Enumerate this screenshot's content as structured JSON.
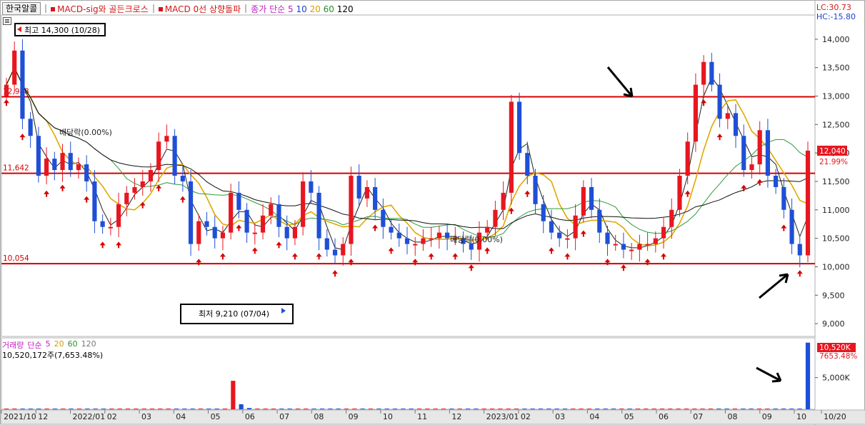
{
  "header": {
    "stock_name": "한국알콜",
    "indicator1": "MACD-sig와 골든크로스",
    "indicator2": "MACD 0선 상향돌파",
    "ma_label": "종가 단순",
    "ma_periods": [
      "5",
      "10",
      "20",
      "60",
      "120"
    ]
  },
  "corner": {
    "lc": "LC:30.73",
    "hc": "HC:-15.80"
  },
  "annotations": {
    "high": "최고 14,300 (10/28)",
    "low": "최저 9,210 (07/04)",
    "dividend1": "배당락(0.00%)",
    "dividend2": "배당락(0.00%)",
    "current_price": "12,040",
    "current_change": "21.99%",
    "hline_labels": [
      "12,988",
      "11,642",
      "10,054"
    ]
  },
  "volume_panel": {
    "title": "거래량",
    "ma_label": "단순",
    "ma_periods": [
      "5",
      "20",
      "60",
      "120"
    ],
    "info": "10,520,172주(7,653.48%)",
    "current_value": "10,520K",
    "current_pct": "7653.48%"
  },
  "colors": {
    "up": "#e8161f",
    "down": "#1e4fd6",
    "ma5": "#202020",
    "ma20": "#e0a800",
    "ma60": "#2e9a3a",
    "ma120": "#111111",
    "hline": "#d40000"
  },
  "chart_data": [
    {
      "type": "candlestick",
      "title": "",
      "ylim": [
        8800,
        14400
      ],
      "y_ticks": [
        "14,000",
        "13,500",
        "13,000",
        "12,500",
        "12,000",
        "11,500",
        "11,000",
        "10,500",
        "10,000",
        "9,500",
        "9,000"
      ],
      "x_ticks": [
        "2021/10",
        "12",
        "2022/01",
        "02",
        "03",
        "04",
        "05",
        "06",
        "07",
        "08",
        "09",
        "10",
        "11",
        "12",
        "2023/01",
        "02",
        "03",
        "04",
        "05",
        "06",
        "07",
        "08",
        "09",
        "10",
        "10/20"
      ],
      "horizontal_lines": [
        12988,
        11642,
        10054
      ],
      "series": [
        {
          "name": "종가",
          "values": [
            13200,
            13800,
            12600,
            12300,
            11600,
            11900,
            11700,
            12000,
            11700,
            11800,
            11500,
            10800,
            10700,
            10700,
            11100,
            11300,
            11400,
            11500,
            11700,
            12200,
            12300,
            11600,
            11500,
            10400,
            10800,
            10700,
            10500,
            10600,
            11300,
            11000,
            10600,
            10600,
            10900,
            11100,
            10700,
            10500,
            10700,
            11500,
            11300,
            10500,
            10300,
            10200,
            10400,
            11600,
            11200,
            11400,
            11000,
            10700,
            10600,
            10500,
            10400,
            10400,
            10500,
            10500,
            10600,
            10500,
            10500,
            10400,
            10300,
            10600,
            10700,
            11000,
            11300,
            12900,
            12000,
            11600,
            11100,
            10800,
            10600,
            10500,
            10500,
            10900,
            11400,
            11000,
            10600,
            10400,
            10400,
            10300,
            10300,
            10400,
            10400,
            10500,
            10700,
            11000,
            11600,
            12200,
            13200,
            13600,
            13200,
            12600,
            12700,
            12300,
            11700,
            11800,
            12400,
            11600,
            11400,
            11000,
            10400,
            10200,
            12040
          ],
          "ma": {
            "5": [],
            "20": [],
            "60": [],
            "120": []
          }
        }
      ],
      "markers": {
        "buy_signals": 42
      }
    },
    {
      "type": "bar",
      "title": "",
      "y_ticks": [
        "5,000K"
      ],
      "ylim": [
        0,
        10600
      ],
      "unit": "K",
      "values": [
        60,
        40,
        30,
        20,
        10,
        10,
        10,
        10,
        10,
        10,
        10,
        10,
        10,
        10,
        10,
        10,
        10,
        10,
        10,
        10,
        10,
        10,
        10,
        10,
        10,
        10,
        10,
        10,
        4500,
        800,
        200,
        100,
        80,
        60,
        40,
        30,
        30,
        30,
        30,
        30,
        30,
        60,
        40,
        30,
        20,
        20,
        20,
        20,
        20,
        20,
        20,
        20,
        20,
        20,
        20,
        20,
        20,
        20,
        20,
        20,
        20,
        20,
        20,
        20,
        40,
        30,
        20,
        20,
        20,
        20,
        20,
        20,
        20,
        20,
        20,
        20,
        20,
        20,
        20,
        20,
        20,
        20,
        20,
        20,
        20,
        20,
        20,
        20,
        20,
        20,
        20,
        20,
        20,
        20,
        20,
        20,
        20,
        20,
        20,
        10520
      ]
    }
  ]
}
